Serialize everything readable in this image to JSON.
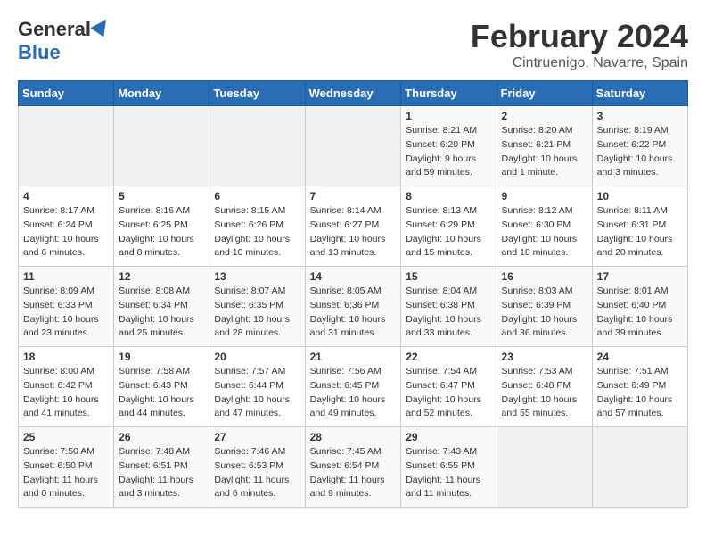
{
  "header": {
    "logo_general": "General",
    "logo_blue": "Blue",
    "title": "February 2024",
    "location": "Cintruenigo, Navarre, Spain"
  },
  "days_of_week": [
    "Sunday",
    "Monday",
    "Tuesday",
    "Wednesday",
    "Thursday",
    "Friday",
    "Saturday"
  ],
  "weeks": [
    [
      {
        "day": "",
        "info": ""
      },
      {
        "day": "",
        "info": ""
      },
      {
        "day": "",
        "info": ""
      },
      {
        "day": "",
        "info": ""
      },
      {
        "day": "1",
        "info": "Sunrise: 8:21 AM\nSunset: 6:20 PM\nDaylight: 9 hours and 59 minutes."
      },
      {
        "day": "2",
        "info": "Sunrise: 8:20 AM\nSunset: 6:21 PM\nDaylight: 10 hours and 1 minute."
      },
      {
        "day": "3",
        "info": "Sunrise: 8:19 AM\nSunset: 6:22 PM\nDaylight: 10 hours and 3 minutes."
      }
    ],
    [
      {
        "day": "4",
        "info": "Sunrise: 8:17 AM\nSunset: 6:24 PM\nDaylight: 10 hours and 6 minutes."
      },
      {
        "day": "5",
        "info": "Sunrise: 8:16 AM\nSunset: 6:25 PM\nDaylight: 10 hours and 8 minutes."
      },
      {
        "day": "6",
        "info": "Sunrise: 8:15 AM\nSunset: 6:26 PM\nDaylight: 10 hours and 10 minutes."
      },
      {
        "day": "7",
        "info": "Sunrise: 8:14 AM\nSunset: 6:27 PM\nDaylight: 10 hours and 13 minutes."
      },
      {
        "day": "8",
        "info": "Sunrise: 8:13 AM\nSunset: 6:29 PM\nDaylight: 10 hours and 15 minutes."
      },
      {
        "day": "9",
        "info": "Sunrise: 8:12 AM\nSunset: 6:30 PM\nDaylight: 10 hours and 18 minutes."
      },
      {
        "day": "10",
        "info": "Sunrise: 8:11 AM\nSunset: 6:31 PM\nDaylight: 10 hours and 20 minutes."
      }
    ],
    [
      {
        "day": "11",
        "info": "Sunrise: 8:09 AM\nSunset: 6:33 PM\nDaylight: 10 hours and 23 minutes."
      },
      {
        "day": "12",
        "info": "Sunrise: 8:08 AM\nSunset: 6:34 PM\nDaylight: 10 hours and 25 minutes."
      },
      {
        "day": "13",
        "info": "Sunrise: 8:07 AM\nSunset: 6:35 PM\nDaylight: 10 hours and 28 minutes."
      },
      {
        "day": "14",
        "info": "Sunrise: 8:05 AM\nSunset: 6:36 PM\nDaylight: 10 hours and 31 minutes."
      },
      {
        "day": "15",
        "info": "Sunrise: 8:04 AM\nSunset: 6:38 PM\nDaylight: 10 hours and 33 minutes."
      },
      {
        "day": "16",
        "info": "Sunrise: 8:03 AM\nSunset: 6:39 PM\nDaylight: 10 hours and 36 minutes."
      },
      {
        "day": "17",
        "info": "Sunrise: 8:01 AM\nSunset: 6:40 PM\nDaylight: 10 hours and 39 minutes."
      }
    ],
    [
      {
        "day": "18",
        "info": "Sunrise: 8:00 AM\nSunset: 6:42 PM\nDaylight: 10 hours and 41 minutes."
      },
      {
        "day": "19",
        "info": "Sunrise: 7:58 AM\nSunset: 6:43 PM\nDaylight: 10 hours and 44 minutes."
      },
      {
        "day": "20",
        "info": "Sunrise: 7:57 AM\nSunset: 6:44 PM\nDaylight: 10 hours and 47 minutes."
      },
      {
        "day": "21",
        "info": "Sunrise: 7:56 AM\nSunset: 6:45 PM\nDaylight: 10 hours and 49 minutes."
      },
      {
        "day": "22",
        "info": "Sunrise: 7:54 AM\nSunset: 6:47 PM\nDaylight: 10 hours and 52 minutes."
      },
      {
        "day": "23",
        "info": "Sunrise: 7:53 AM\nSunset: 6:48 PM\nDaylight: 10 hours and 55 minutes."
      },
      {
        "day": "24",
        "info": "Sunrise: 7:51 AM\nSunset: 6:49 PM\nDaylight: 10 hours and 57 minutes."
      }
    ],
    [
      {
        "day": "25",
        "info": "Sunrise: 7:50 AM\nSunset: 6:50 PM\nDaylight: 11 hours and 0 minutes."
      },
      {
        "day": "26",
        "info": "Sunrise: 7:48 AM\nSunset: 6:51 PM\nDaylight: 11 hours and 3 minutes."
      },
      {
        "day": "27",
        "info": "Sunrise: 7:46 AM\nSunset: 6:53 PM\nDaylight: 11 hours and 6 minutes."
      },
      {
        "day": "28",
        "info": "Sunrise: 7:45 AM\nSunset: 6:54 PM\nDaylight: 11 hours and 9 minutes."
      },
      {
        "day": "29",
        "info": "Sunrise: 7:43 AM\nSunset: 6:55 PM\nDaylight: 11 hours and 11 minutes."
      },
      {
        "day": "",
        "info": ""
      },
      {
        "day": "",
        "info": ""
      }
    ]
  ]
}
